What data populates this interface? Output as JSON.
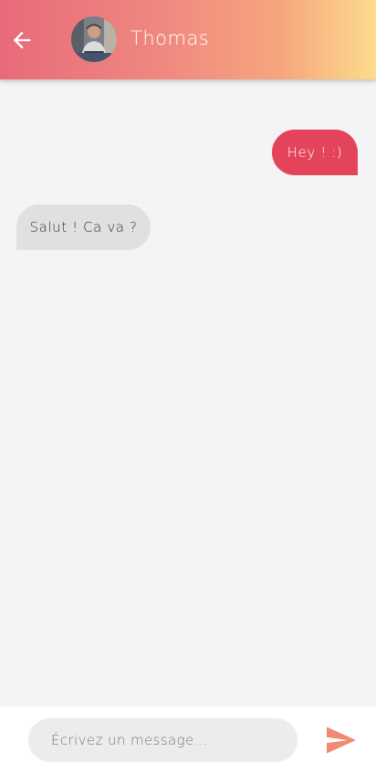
{
  "header": {
    "back_icon": "arrow-left-icon",
    "avatar_alt": "Thomas",
    "contact_name": "Thomas",
    "gradient": [
      "#e86a7a",
      "#f6a67e",
      "#fcdc8c"
    ]
  },
  "messages": [
    {
      "direction": "sent",
      "text": "Hey ! :)",
      "color": "#e3445c"
    },
    {
      "direction": "received",
      "text": "Salut ! Ca va ?",
      "color": "#e0e0e0"
    }
  ],
  "composer": {
    "placeholder": "Écrivez un message...",
    "value": "",
    "send_icon": "send-icon",
    "send_color": "#f08a72"
  }
}
